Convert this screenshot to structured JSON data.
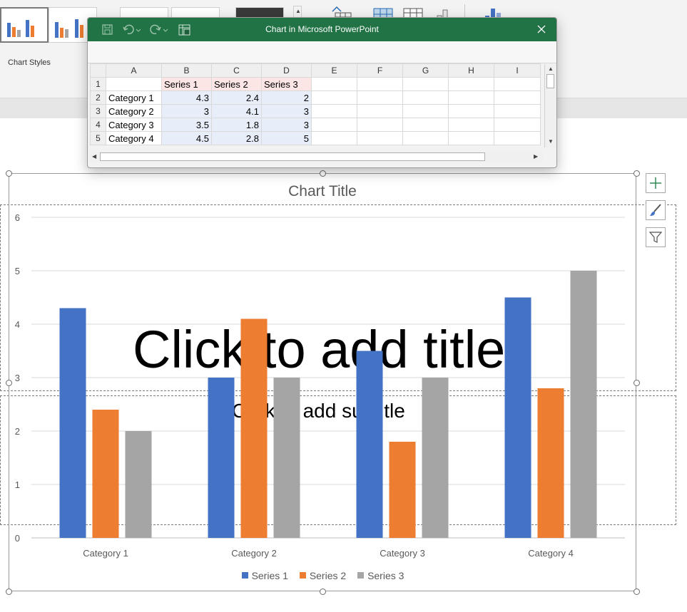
{
  "ribbon": {
    "chart_styles_label": "Chart Styles"
  },
  "slide": {
    "title_placeholder": "Click to add title",
    "subtitle_placeholder": "Click to add subtitle"
  },
  "datasheet": {
    "title": "Chart in Microsoft PowerPoint",
    "columns": [
      "A",
      "B",
      "C",
      "D",
      "E",
      "F",
      "G",
      "H",
      "I"
    ],
    "row_numbers": [
      "1",
      "2",
      "3",
      "4",
      "5"
    ],
    "header_row": [
      "",
      "Series 1",
      "Series 2",
      "Series 3"
    ],
    "rows": [
      [
        "Category 1",
        "4.3",
        "2.4",
        "2"
      ],
      [
        "Category 2",
        "3",
        "4.1",
        "3"
      ],
      [
        "Category 3",
        "3.5",
        "1.8",
        "3"
      ],
      [
        "Category 4",
        "4.5",
        "2.8",
        "5"
      ]
    ]
  },
  "colors": {
    "series1": "#4472c4",
    "series2": "#ed7d31",
    "series3": "#a5a5a5",
    "titlebar": "#217346"
  },
  "icons": [
    "save-icon",
    "undo-icon",
    "redo-icon",
    "edit-in-excel-icon",
    "close-icon",
    "add-chart-element-icon",
    "chart-styles-brush-icon",
    "chart-filter-icon"
  ],
  "chart_data": {
    "type": "bar",
    "title": "Chart Title",
    "categories": [
      "Category 1",
      "Category 2",
      "Category 3",
      "Category 4"
    ],
    "series": [
      {
        "name": "Series 1",
        "values": [
          4.3,
          3,
          3.5,
          4.5
        ]
      },
      {
        "name": "Series 2",
        "values": [
          2.4,
          4.1,
          1.8,
          2.8
        ]
      },
      {
        "name": "Series 3",
        "values": [
          2,
          3,
          3,
          5
        ]
      }
    ],
    "ylim": [
      0,
      6
    ],
    "yticks": [
      "0",
      "1",
      "2",
      "3",
      "4",
      "5",
      "6"
    ],
    "grid": true,
    "legend": "bottom"
  }
}
